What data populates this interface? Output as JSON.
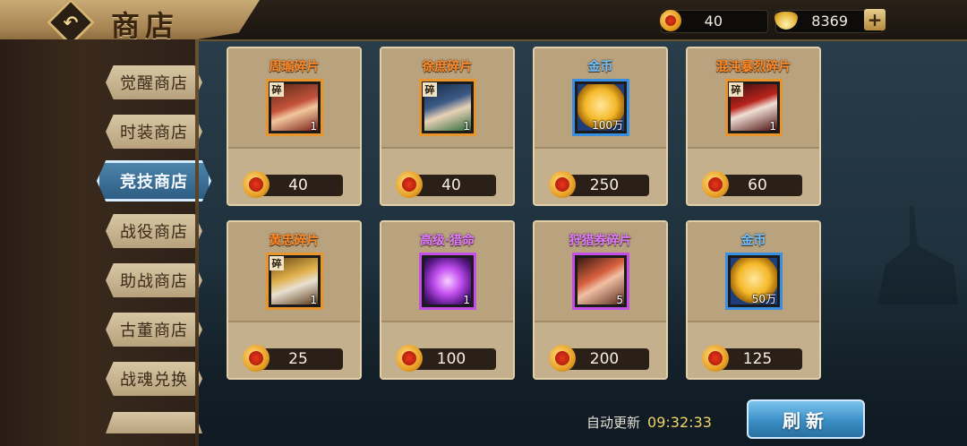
{
  "header": {
    "title": "商店",
    "back_icon": "back-arrow-icon",
    "currency_coin": "40",
    "currency_gold": "8369",
    "add_icon": "plus-icon"
  },
  "sidebar": {
    "items": [
      {
        "label": "觉醒商店",
        "active": false
      },
      {
        "label": "时装商店",
        "active": false
      },
      {
        "label": "竞技商店",
        "active": true
      },
      {
        "label": "战役商店",
        "active": false
      },
      {
        "label": "助战商店",
        "active": false
      },
      {
        "label": "古董商店",
        "active": false
      },
      {
        "label": "战魂兑换",
        "active": false
      }
    ]
  },
  "shop": {
    "items": [
      {
        "name": "周瑜碎片",
        "count": "1",
        "price": "40",
        "fragment": "碎"
      },
      {
        "name": "徐庶碎片",
        "count": "1",
        "price": "40",
        "fragment": "碎"
      },
      {
        "name": "金币",
        "count": "100万",
        "price": "250"
      },
      {
        "name": "混沌暴烈碎片",
        "count": "1",
        "price": "60",
        "fragment": "碎"
      },
      {
        "name": "黄忠碎片",
        "count": "1",
        "price": "25",
        "fragment": "碎"
      },
      {
        "name": "高级·猎命",
        "count": "1",
        "price": "100"
      },
      {
        "name": "狩猎券碎片",
        "count": "5",
        "price": "200"
      },
      {
        "name": "金币",
        "count": "50万",
        "price": "125"
      }
    ]
  },
  "footer": {
    "auto_label": "自动更新",
    "auto_time": "09:32:33",
    "refresh_label": "刷新"
  },
  "colors": {
    "accent_blue": "#3a8fc6",
    "rarity_orange": "#e8952c",
    "rarity_blue": "#3b8fe0",
    "rarity_purple": "#c44fe6"
  }
}
